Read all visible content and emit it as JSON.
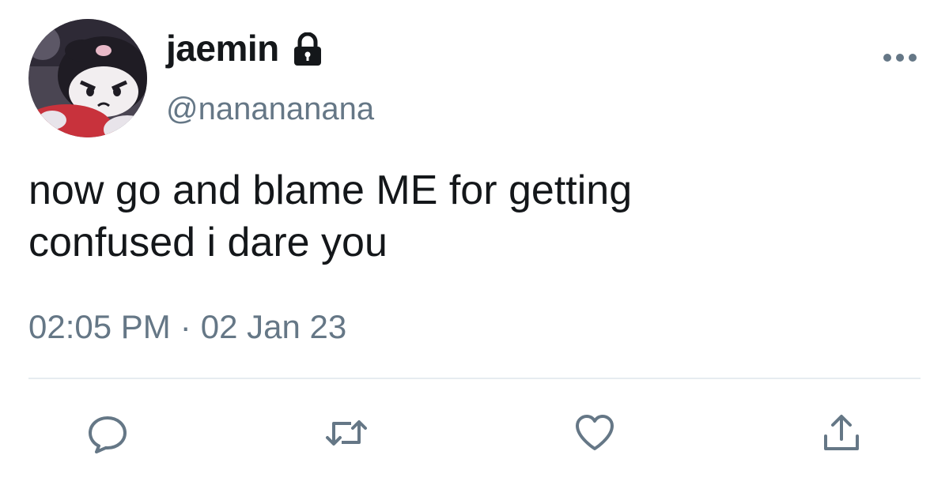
{
  "tweet": {
    "display_name": "jaemin",
    "handle": "@nanananana",
    "text": "now go and blame ME for getting\nconfused i dare you",
    "time": "02:05 PM",
    "separator": "·",
    "date": "02 Jan 23"
  },
  "icons": {
    "lock": "lock-icon",
    "more": "more-dots-icon",
    "reply": "reply-bubble-icon",
    "retweet": "retweet-icon",
    "like": "heart-icon",
    "share": "share-upload-icon"
  },
  "colors": {
    "text_primary": "#14171a",
    "text_secondary": "#657786",
    "divider": "#e6ecf0",
    "icon": "#657786"
  }
}
